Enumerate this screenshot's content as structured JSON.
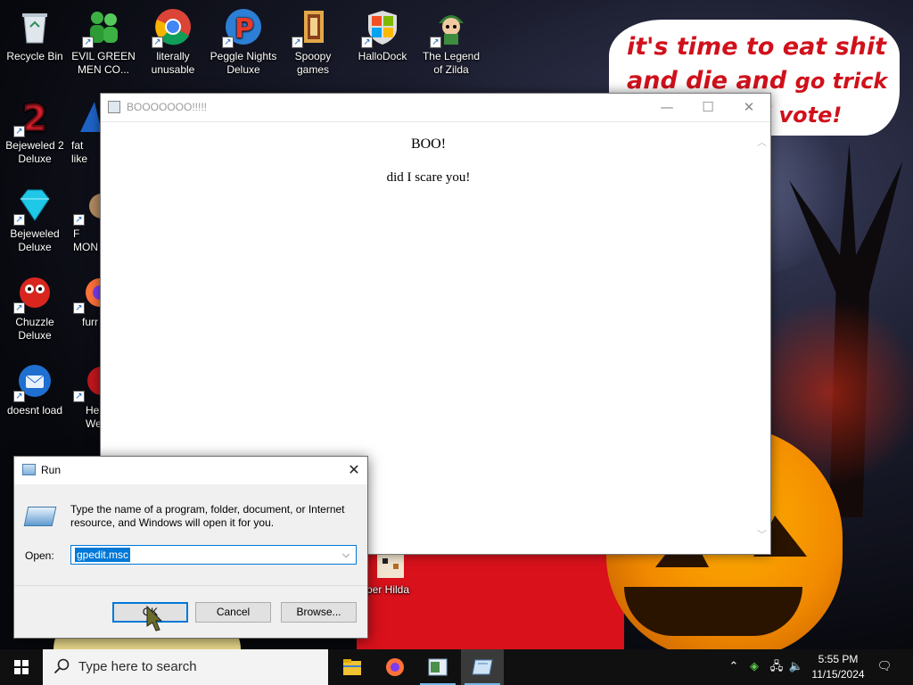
{
  "desktop": {
    "icons": [
      {
        "label": "Recycle Bin",
        "icon": "recycle-bin-icon"
      },
      {
        "label": "EVIL GREEN MEN CO...",
        "icon": "green-men-icon"
      },
      {
        "label": "literally unusable",
        "icon": "chrome-icon"
      },
      {
        "label": "Peggle Nights Deluxe",
        "icon": "peggle-icon"
      },
      {
        "label": "Spoopy games",
        "icon": "folder-icon"
      },
      {
        "label": "HalloDock",
        "icon": "windows-logo-icon"
      },
      {
        "label": "The Legend of Zilda",
        "icon": "zilda-icon"
      },
      {
        "label": "Bejeweled 2 Deluxe",
        "icon": "bejeweled2-icon"
      },
      {
        "label": "fat like",
        "icon": "app-icon"
      },
      {
        "label": "Bejeweled Deluxe",
        "icon": "diamond-icon"
      },
      {
        "label": "F MON",
        "icon": "app-icon"
      },
      {
        "label": "Chuzzle Deluxe",
        "icon": "chuzzle-icon"
      },
      {
        "label": "furr",
        "icon": "firefox-icon"
      },
      {
        "label": "doesnt load",
        "icon": "thunderbird-icon"
      },
      {
        "label": "He We",
        "icon": "app-icon"
      },
      {
        "label": "per Hilda",
        "icon": "hilda-icon"
      }
    ],
    "speech_bubble": {
      "line1": "it's time to eat shit",
      "line2a": "and die and",
      "line2b": "go trick",
      "line3": "d vote!"
    }
  },
  "boo_window": {
    "title": "BOOOOOOO!!!!!",
    "heading": "BOO!",
    "text": "did I scare you!",
    "controls": {
      "minimize": "—",
      "maximize": "☐",
      "close": "✕"
    }
  },
  "run_dialog": {
    "title": "Run",
    "description": "Type the name of a program, folder, document, or Internet resource, and Windows will open it for you.",
    "open_label": "Open:",
    "input_value": "gpedit.msc",
    "ok_label": "OK",
    "cancel_label": "Cancel",
    "browse_label": "Browse..."
  },
  "taskbar": {
    "search_placeholder": "Type here to search",
    "apps": [
      "file-explorer-icon",
      "firefox-icon",
      "notepad-icon",
      "run-icon"
    ],
    "clock_time": "5:55 PM",
    "clock_date": "11/15/2024"
  }
}
